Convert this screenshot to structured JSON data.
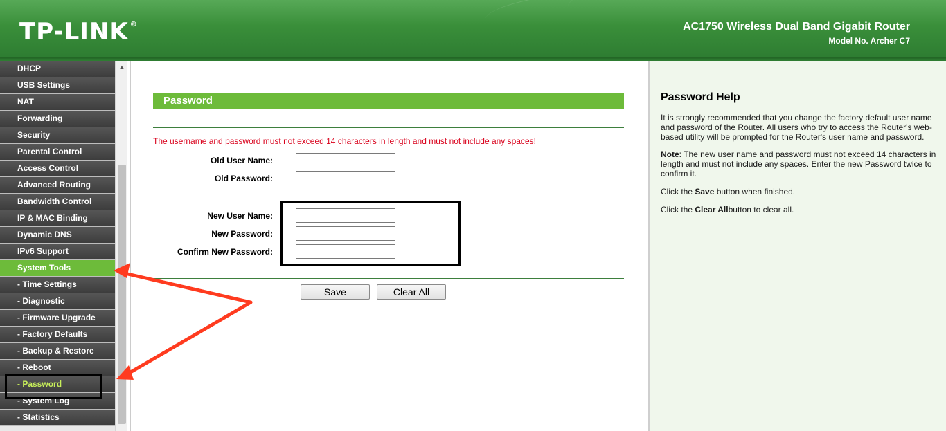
{
  "header": {
    "logo": "TP-LINK",
    "logo_mark": "®",
    "product_title": "AC1750 Wireless Dual Band Gigabit Router",
    "model": "Model No. Archer C7",
    "accent_color": "#3a8f3a"
  },
  "sidebar": {
    "items": [
      {
        "label": "DHCP"
      },
      {
        "label": "USB Settings"
      },
      {
        "label": "NAT"
      },
      {
        "label": "Forwarding"
      },
      {
        "label": "Security"
      },
      {
        "label": "Parental Control"
      },
      {
        "label": "Access Control"
      },
      {
        "label": "Advanced Routing"
      },
      {
        "label": "Bandwidth Control"
      },
      {
        "label": "IP & MAC Binding"
      },
      {
        "label": "Dynamic DNS"
      },
      {
        "label": "IPv6 Support"
      },
      {
        "label": "System Tools"
      },
      {
        "label": "- Time Settings"
      },
      {
        "label": "- Diagnostic"
      },
      {
        "label": "- Firmware Upgrade"
      },
      {
        "label": "- Factory Defaults"
      },
      {
        "label": "- Backup & Restore"
      },
      {
        "label": "- Reboot"
      },
      {
        "label": "- Password"
      },
      {
        "label": "- System Log"
      },
      {
        "label": "- Statistics"
      }
    ],
    "active_color": "#6dbb3a",
    "current_color": "#c8ef5a"
  },
  "main": {
    "title": "Password",
    "warning": "The username and password must not exceed 14 characters in length and must not include any spaces!",
    "fields": {
      "old_user_name": {
        "label": "Old User Name:",
        "value": ""
      },
      "old_password": {
        "label": "Old Password:",
        "value": ""
      },
      "new_user_name": {
        "label": "New User Name:",
        "value": ""
      },
      "new_password": {
        "label": "New Password:",
        "value": ""
      },
      "confirm_password": {
        "label": "Confirm New Password:",
        "value": ""
      }
    },
    "save_label": "Save",
    "clear_label": "Clear All",
    "warning_color": "#d9001b"
  },
  "help": {
    "title": "Password Help",
    "p1": "It is strongly recommended that you change the factory default user name and password of the Router. All users who try to access the Router's web-based utility will be prompted for the Router's user name and password.",
    "note_label": "Note",
    "note_text": ": The new user name and password must not exceed 14 characters in length and must not include any spaces. Enter the new Password twice to confirm it.",
    "p3_pre": "Click the ",
    "p3_bold": "Save",
    "p3_post": " button when finished.",
    "p4_pre": "Click the ",
    "p4_bold": "Clear All",
    "p4_post": "button to clear all."
  }
}
